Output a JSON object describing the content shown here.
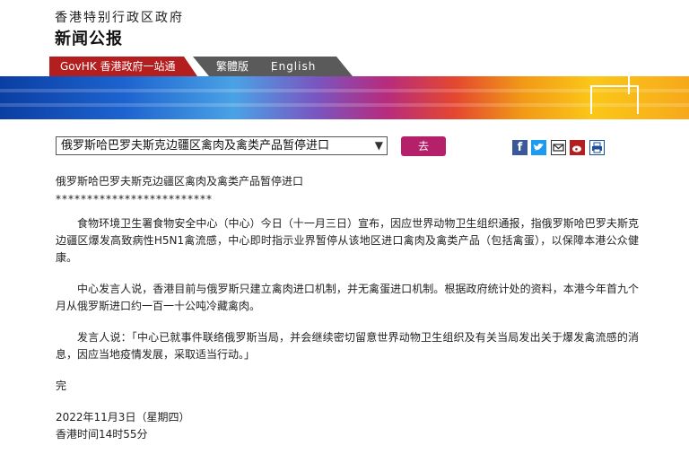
{
  "header": {
    "gov_title": "香港特别行政区政府",
    "press_title": "新闻公报"
  },
  "tabs": {
    "govhk": "GovHK 香港政府一站通",
    "traditional": "繁體版",
    "english": "English"
  },
  "nav": {
    "selected": "俄罗斯哈巴罗夫斯克边疆区禽肉及禽类产品暂停进口",
    "go": "去"
  },
  "share_icons": [
    "facebook-icon",
    "twitter-icon",
    "email-icon",
    "weibo-icon",
    "print-icon"
  ],
  "article": {
    "headline": "俄罗斯哈巴罗夫斯克边疆区禽肉及禽类产品暂停进口",
    "stars": "*************************",
    "paragraphs": [
      "食物环境卫生署食物安全中心（中心）今日（十一月三日）宣布，因应世界动物卫生组织通报，指俄罗斯哈巴罗夫斯克边疆区爆发高致病性H5N1禽流感，中心即时指示业界暂停从该地区进口禽肉及禽类产品（包括禽蛋），以保障本港公众健康。",
      "中心发言人说，香港目前与俄罗斯只建立禽肉进口机制，并无禽蛋进口机制。根据政府统计处的资料，本港今年首九个月从俄罗斯进口约一百一十公吨冷藏禽肉。",
      "发言人说：「中心已就事件联络俄罗斯当局，并会继续密切留意世界动物卫生组织及有关当局发出关于爆发禽流感的消息，因应当地疫情发展，采取适当行动。」"
    ],
    "end": "完",
    "date": "2022年11月3日（星期四）",
    "time": "香港时间14时55分"
  },
  "colors": {
    "govhk_tab": "#b41e1e",
    "lang_tab": "#5a5a5a",
    "go_button": "#b5206a"
  }
}
